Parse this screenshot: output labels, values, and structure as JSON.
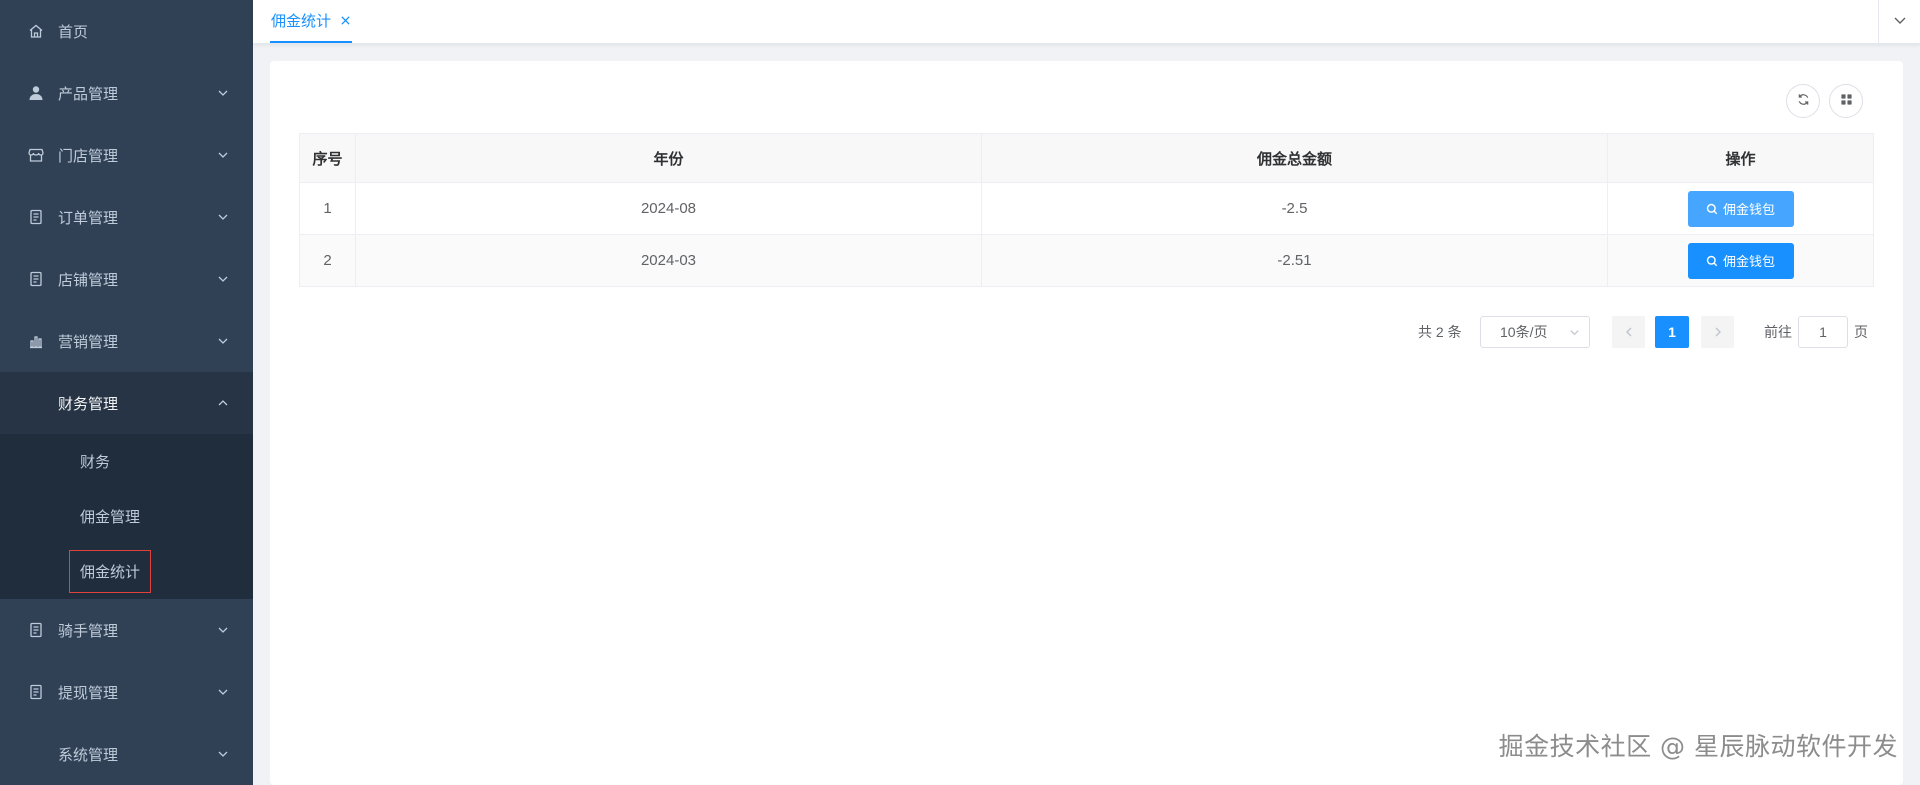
{
  "sidebar": {
    "items": [
      {
        "label": "首页",
        "icon": "home-icon",
        "has_arrow": false
      },
      {
        "label": "产品管理",
        "icon": "user-icon",
        "has_arrow": true
      },
      {
        "label": "门店管理",
        "icon": "store-icon",
        "has_arrow": true
      },
      {
        "label": "订单管理",
        "icon": "document-icon",
        "has_arrow": true
      },
      {
        "label": "店铺管理",
        "icon": "document-icon",
        "has_arrow": true
      },
      {
        "label": "营销管理",
        "icon": "bar-chart-icon",
        "has_arrow": true
      },
      {
        "label": "财务管理",
        "icon": "",
        "has_arrow": true,
        "open": true,
        "children": [
          {
            "label": "财务"
          },
          {
            "label": "佣金管理"
          },
          {
            "label": "佣金统计",
            "active": true
          }
        ]
      },
      {
        "label": "骑手管理",
        "icon": "document-icon",
        "has_arrow": true
      },
      {
        "label": "提现管理",
        "icon": "document-icon",
        "has_arrow": true
      },
      {
        "label": "系统管理",
        "icon": "",
        "has_arrow": true
      }
    ]
  },
  "tabs": [
    {
      "label": "佣金统计",
      "active": true
    }
  ],
  "table": {
    "columns": [
      "序号",
      "年份",
      "佣金总金额",
      "操作"
    ],
    "rows": [
      {
        "index": "1",
        "year": "2024-08",
        "total": "-2.5",
        "action": "佣金钱包"
      },
      {
        "index": "2",
        "year": "2024-03",
        "total": "-2.51",
        "action": "佣金钱包"
      }
    ]
  },
  "pagination": {
    "total_text": "共 2 条",
    "page_size": "10条/页",
    "current_page": "1",
    "goto_prefix": "前往",
    "goto_value": "1",
    "goto_suffix": "页"
  },
  "watermark": "掘金技术社区 @ 星辰脉动软件开发",
  "colors": {
    "sidebar_bg": "#304156",
    "submenu_bg": "#1f2d3d",
    "primary": "#1890ff",
    "active_outline": "#e0413a"
  }
}
